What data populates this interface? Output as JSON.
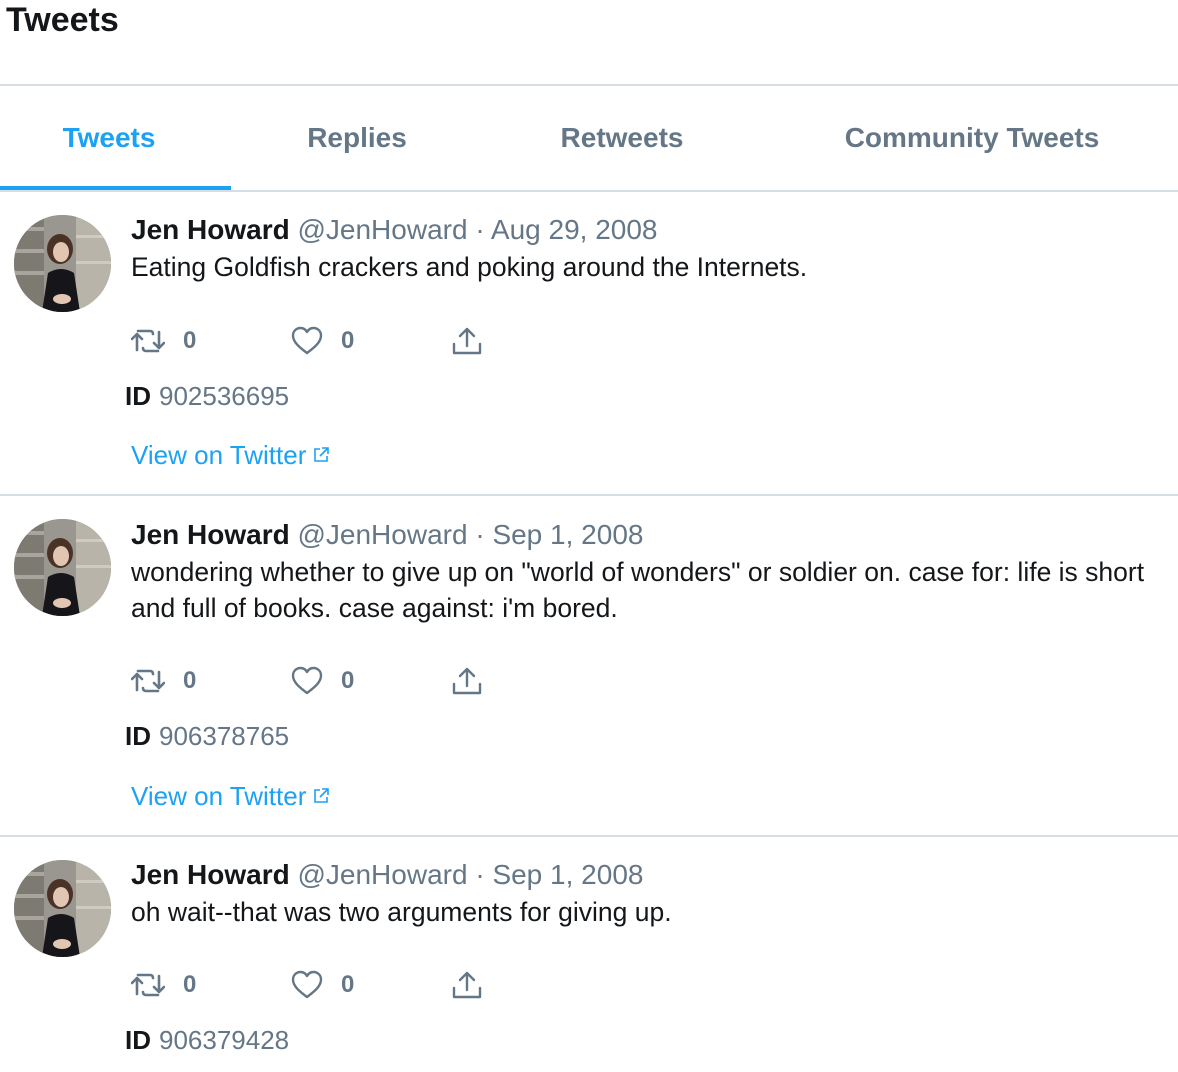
{
  "header": {
    "title": "Tweets"
  },
  "tabs": [
    {
      "label": "Tweets",
      "active": true
    },
    {
      "label": "Replies",
      "active": false
    },
    {
      "label": "Retweets",
      "active": false
    },
    {
      "label": "Community Tweets",
      "active": false
    }
  ],
  "colors": {
    "accent": "#1da1f2",
    "muted": "#657786",
    "text": "#14171a",
    "divider": "#d6dde3"
  },
  "tweets": [
    {
      "name": "Jen Howard",
      "handle": "@JenHoward",
      "separator": "·",
      "date": "Aug 29, 2008",
      "text": "Eating Goldfish crackers and poking around the Internets.",
      "retweets": "0",
      "likes": "0",
      "id_label": "ID",
      "id": "902536695",
      "link": "View on Twitter"
    },
    {
      "name": "Jen Howard",
      "handle": "@JenHoward",
      "separator": "·",
      "date": "Sep 1, 2008",
      "text": "wondering whether to give up on \"world of wonders\" or soldier on. case for: life is short and full of books. case against: i'm bored.",
      "retweets": "0",
      "likes": "0",
      "id_label": "ID",
      "id": "906378765",
      "link": "View on Twitter"
    },
    {
      "name": "Jen Howard",
      "handle": "@JenHoward",
      "separator": "·",
      "date": "Sep 1, 2008",
      "text": "oh wait--that was two arguments for giving up.",
      "retweets": "0",
      "likes": "0",
      "id_label": "ID",
      "id": "906379428"
    }
  ],
  "icons": {
    "retweet": "retweet-icon",
    "like": "heart-icon",
    "share": "share-icon",
    "external": "external-link-icon"
  }
}
